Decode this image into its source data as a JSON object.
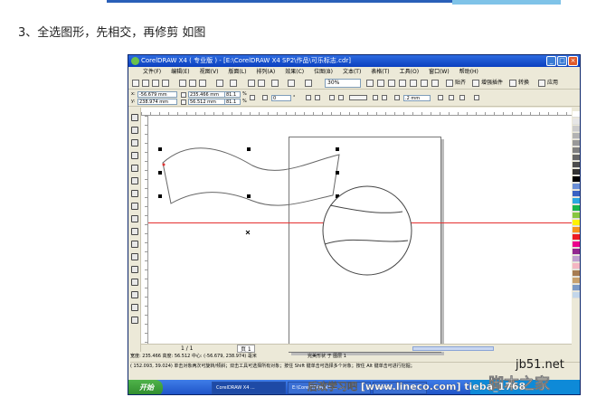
{
  "article": {
    "step_caption": "3、全选图形，先相交，再修剪 如图"
  },
  "window": {
    "title": "CorelDRAW X4 ( 专业版 ) - [E:\\CorelDRAW X4 SP2\\作品\\可乐标志.cdr]",
    "controls": [
      "_",
      "□",
      "×"
    ]
  },
  "menu": [
    "文件(F)",
    "编辑(E)",
    "视图(V)",
    "版面(L)",
    "排列(A)",
    "效果(C)",
    "位图(B)",
    "文本(T)",
    "表格(T)",
    "工具(O)",
    "窗口(W)",
    "帮助(H)"
  ],
  "toolbar": {
    "zoom": "30%",
    "snap_label": "贴齐",
    "enhance_label": "增强插件",
    "convert_label": "转换",
    "app_label": "应用"
  },
  "property_bar": {
    "x": "-56.679 mm",
    "y": "238.974 mm",
    "width": "235.466 mm",
    "height": "56.512 mm",
    "scale_x": "81.1",
    "scale_y": "81.1",
    "scale_unit": "%",
    "rotation": "0",
    "rotation_unit": "°",
    "outline_width": ".2 mm"
  },
  "document": {
    "page_nav": "1 / 1",
    "page_tab": "页 1"
  },
  "status": {
    "line1_left": "宽度: 235.466 高度: 56.512 中心: (-56.679, 238.974) 毫米",
    "line1_right": "完美形状 于 图层 1",
    "line2": "( 152.093, 39.024)        单击对象两次可旋转/倾斜；双击工具可选择所有对象；按住 Shift 键单击可选择多个对象；按住 Alt 键单击可进行挖掘；"
  },
  "taskbar": {
    "start": "开始",
    "buttons": [
      "CorelDRAW X4 ...",
      "E:\\CorelDRAW X4 ...",
      "Corel ..."
    ]
  },
  "watermarks": {
    "site": "jb51.net",
    "brand": "脚本之家",
    "forum": "后改学习吧 [www.lineco.com] tieba_1768"
  },
  "colors": {
    "title_bar": "#0a3fbf",
    "guide_line": "#e53030",
    "taskbar": "#1b4fc4",
    "start_button": "#2e8a2c"
  }
}
